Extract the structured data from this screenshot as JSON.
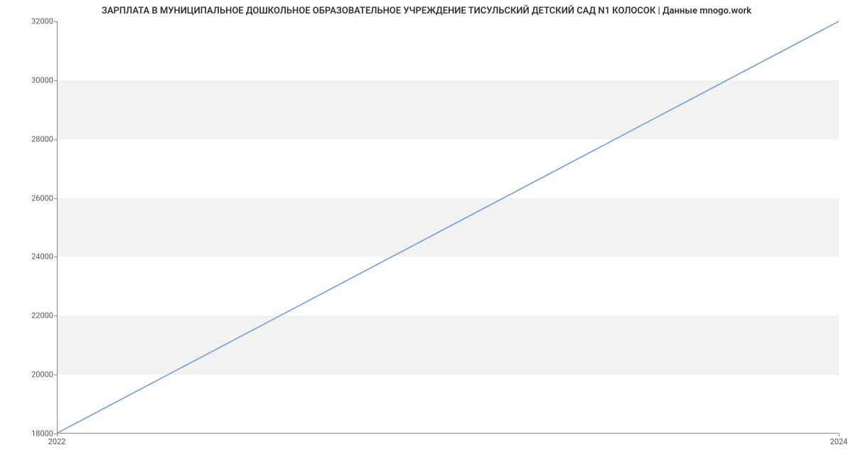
{
  "chart_data": {
    "type": "line",
    "title": "ЗАРПЛАТА В МУНИЦИПАЛЬНОЕ ДОШКОЛЬНОЕ ОБРАЗОВАТЕЛЬНОЕ УЧРЕЖДЕНИЕ ТИСУЛЬСКИЙ ДЕТСКИЙ САД N1 КОЛОСОК | Данные mnogo.work",
    "x": [
      2022,
      2024
    ],
    "values": [
      18000,
      32000
    ],
    "xlabel": "",
    "ylabel": "",
    "xlim": [
      2022,
      2024
    ],
    "ylim": [
      18000,
      32000
    ],
    "x_ticks": [
      2022,
      2024
    ],
    "y_ticks": [
      18000,
      20000,
      22000,
      24000,
      26000,
      28000,
      30000,
      32000
    ],
    "line_color": "#6699dd",
    "band_color": "#f2f2f2"
  }
}
